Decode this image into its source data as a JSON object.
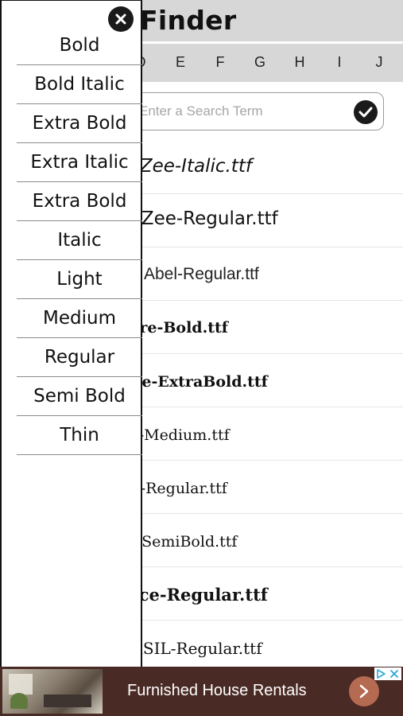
{
  "header": {
    "title": "Finder"
  },
  "letters": [
    "D",
    "E",
    "F",
    "G",
    "H",
    "I",
    "J"
  ],
  "search": {
    "placeholder": "Enter a Search Term",
    "value": ""
  },
  "font_rows": [
    "ABeeZee-Italic.ttf",
    "ABeeZee-Regular.ttf",
    "Abel-Regular.ttf",
    "AbhayaLibre-Bold.ttf",
    "AbhayaLibre-ExtraBold.ttf",
    "AbhayaLibre-Medium.ttf",
    "AbhayaLibre-Regular.ttf",
    "AbhayaLibre-SemiBold.ttf",
    "AbrilFatface-Regular.ttf",
    "AbyssinicaSIL-Regular.ttf"
  ],
  "menu": {
    "items": [
      "Bold",
      "Bold Italic",
      "Extra Bold",
      "Extra Italic",
      "Extra Bold",
      "Italic",
      "Light",
      "Medium",
      "Regular",
      "Semi Bold",
      "Thin"
    ]
  },
  "ad": {
    "text": "Furnished House Rentals"
  },
  "icons": {
    "close": "close-icon",
    "search_go": "checkmark-icon",
    "ad_arrow": "chevron-right-icon",
    "adchoices": "adchoices-icon"
  },
  "colors": {
    "header_bg": "#d7d7d7",
    "ad_bg": "#4a2a24",
    "ad_arrow": "#b56a52"
  }
}
